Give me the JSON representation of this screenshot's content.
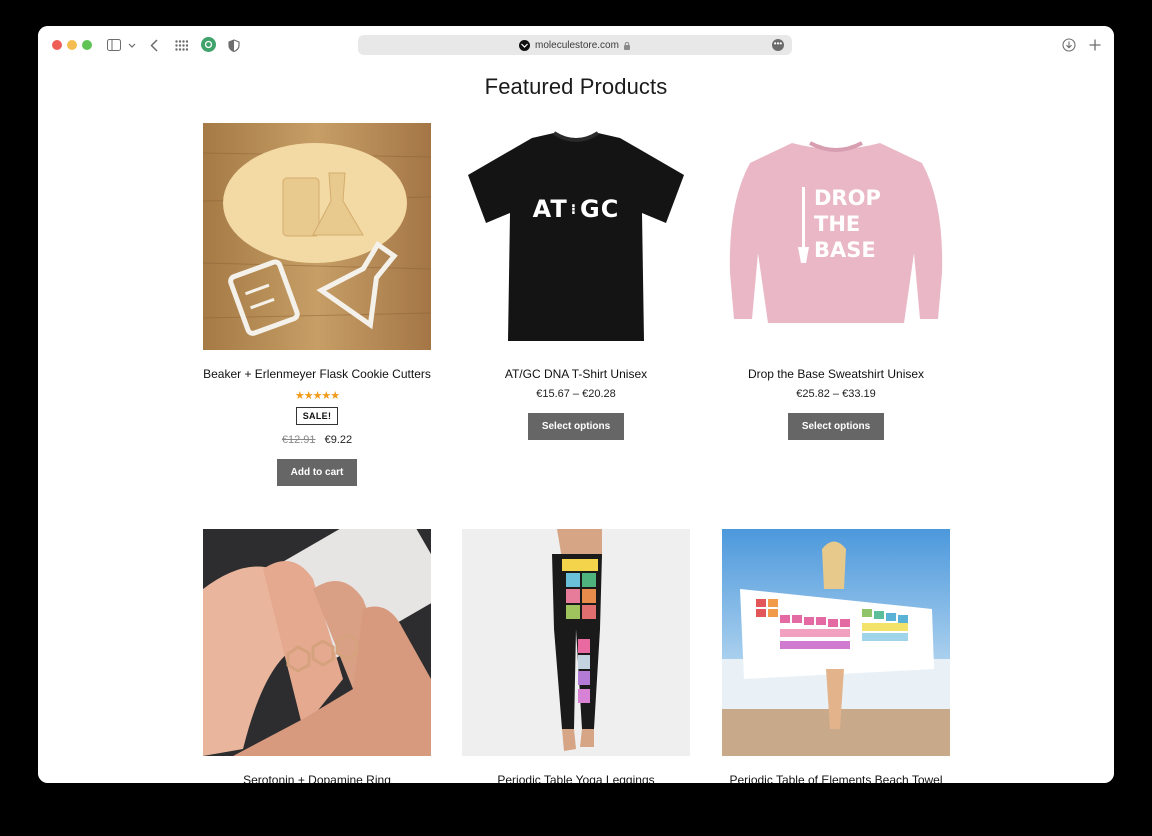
{
  "browser": {
    "url": "moleculestore.com"
  },
  "page": {
    "heading": "Featured Products"
  },
  "products": [
    {
      "name": "Beaker + Erlenmeyer Flask Cookie Cutters",
      "rating_stars": 5,
      "stars_text": "★★★★★",
      "badge": "SALE!",
      "old_price": "€12.91",
      "price": "€9.22",
      "button": "Add to cart"
    },
    {
      "name": "AT/GC DNA T-Shirt Unisex",
      "price": "€15.67 – €20.28",
      "button": "Select options",
      "print_text_left": "AT",
      "print_text_right": "GC"
    },
    {
      "name": "Drop the Base Sweatshirt Unisex",
      "price": "€25.82 – €33.19",
      "button": "Select options",
      "print_lines": [
        "DROP",
        "THE",
        "BASE"
      ]
    },
    {
      "name": "Serotonin + Dopamine Ring"
    },
    {
      "name": "Periodic Table Yoga Leggings"
    },
    {
      "name": "Periodic Table of Elements Beach Towel"
    }
  ]
}
